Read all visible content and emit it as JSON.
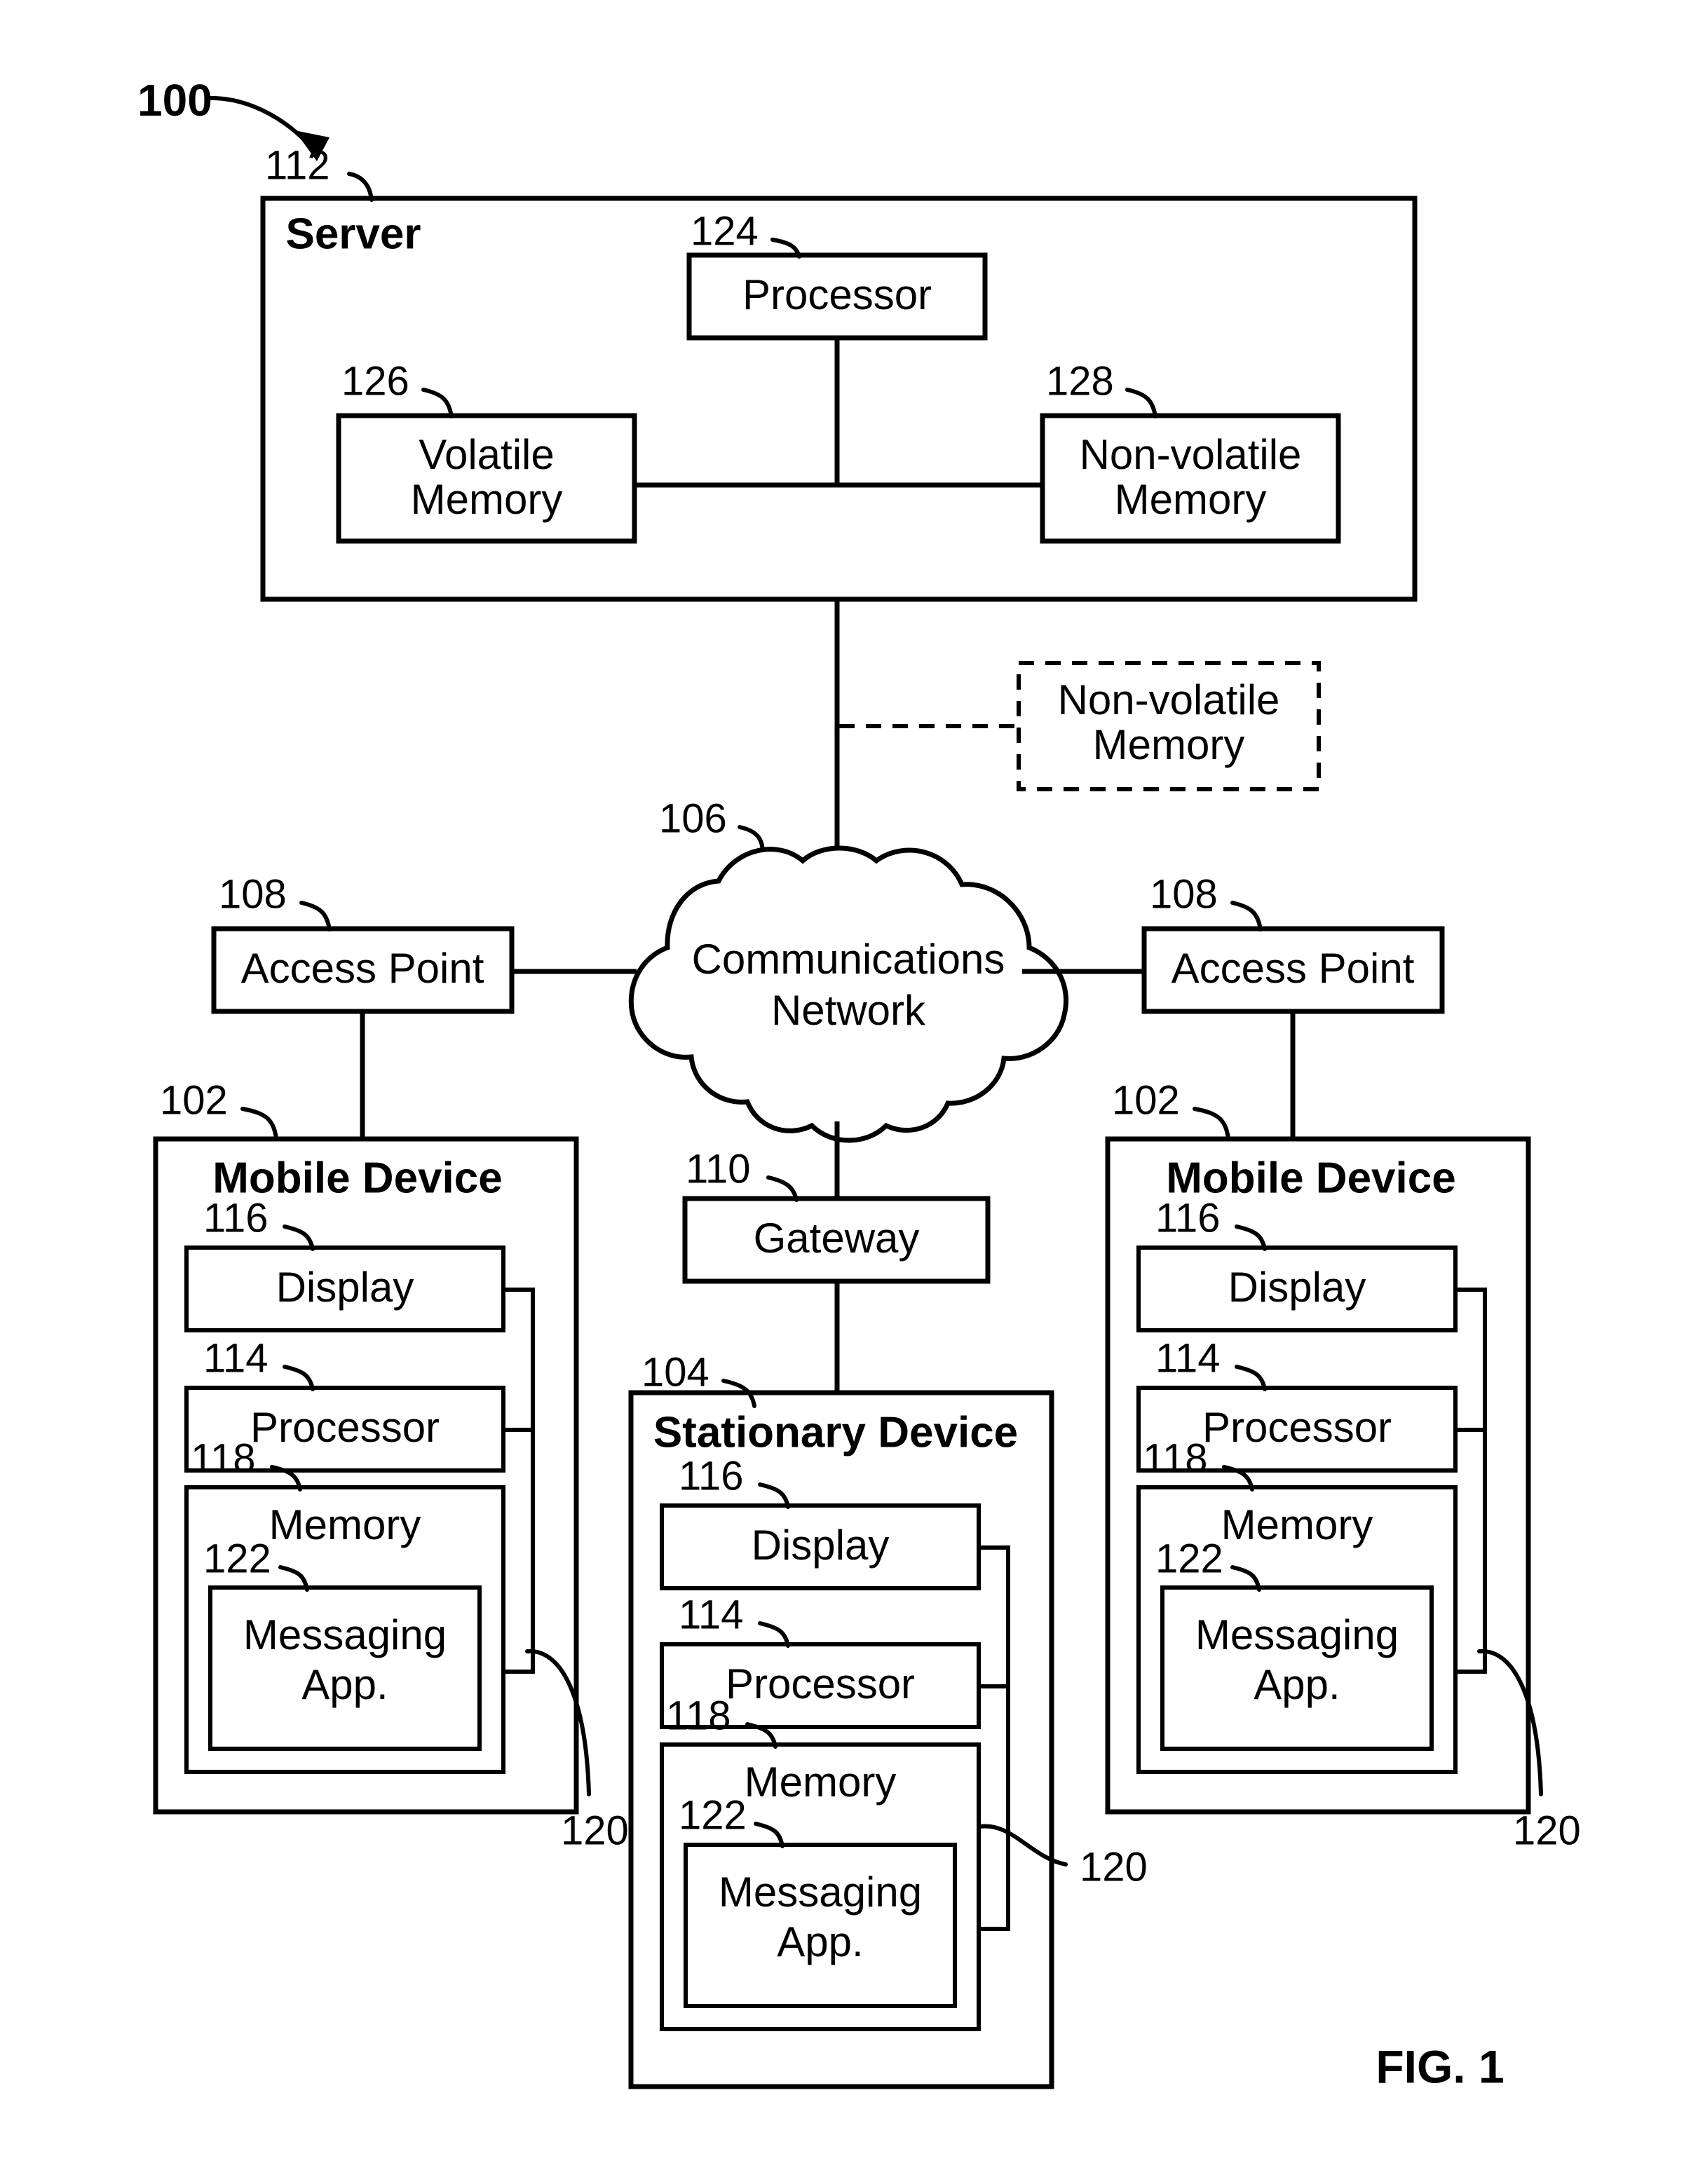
{
  "figure": {
    "label": "FIG. 1",
    "system_ref": "100"
  },
  "server": {
    "ref": "112",
    "title": "Server",
    "components": [
      {
        "ref": "124",
        "label": "Processor"
      },
      {
        "ref": "126",
        "label": "Volatile Memory"
      },
      {
        "ref": "128",
        "label": "Non-volatile Memory"
      }
    ]
  },
  "external_storage": {
    "label": "Non-volatile Memory",
    "style": "dashed"
  },
  "network": {
    "ref": "106",
    "label": "Communications Network",
    "shape": "cloud"
  },
  "access_point_left": {
    "ref": "108",
    "label": "Access Point"
  },
  "access_point_right": {
    "ref": "108",
    "label": "Access Point"
  },
  "gateway": {
    "ref": "110",
    "label": "Gateway"
  },
  "mobile_device_left": {
    "ref": "102",
    "title": "Mobile Device",
    "bus_ref": "120",
    "components": [
      {
        "ref": "116",
        "label": "Display"
      },
      {
        "ref": "114",
        "label": "Processor"
      },
      {
        "ref": "118",
        "label": "Memory"
      },
      {
        "ref": "122",
        "label": "Messaging App."
      }
    ]
  },
  "mobile_device_right": {
    "ref": "102",
    "title": "Mobile Device",
    "bus_ref": "120",
    "components": [
      {
        "ref": "116",
        "label": "Display"
      },
      {
        "ref": "114",
        "label": "Processor"
      },
      {
        "ref": "118",
        "label": "Memory"
      },
      {
        "ref": "122",
        "label": "Messaging App."
      }
    ]
  },
  "stationary_device": {
    "ref": "104",
    "title": "Stationary Device",
    "bus_ref": "120",
    "components": [
      {
        "ref": "116",
        "label": "Display"
      },
      {
        "ref": "114",
        "label": "Processor"
      },
      {
        "ref": "118",
        "label": "Memory"
      },
      {
        "ref": "122",
        "label": "Messaging App."
      }
    ]
  },
  "colors": {
    "stroke": "#000000",
    "background": "#ffffff"
  }
}
